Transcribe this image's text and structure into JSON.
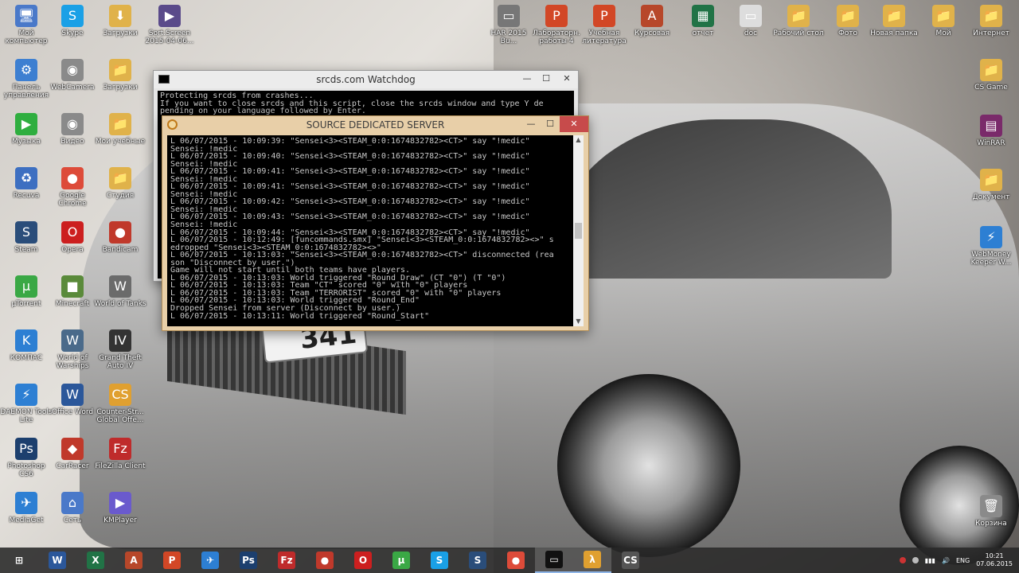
{
  "desktop": {
    "plate_text": "341",
    "icons_left": [
      {
        "label": "Мой компьютер",
        "glyph": "🖥",
        "color": "#4a79c9",
        "icon": "computer-icon"
      },
      {
        "label": "Skype",
        "glyph": "S",
        "color": "#1aa0e6",
        "icon": "skype-icon"
      },
      {
        "label": "Загрузки",
        "glyph": "⬇",
        "color": "#e0b24a",
        "icon": "downloads-icon"
      },
      {
        "label": "Sort.Screen 2015-04-06...",
        "glyph": "▶",
        "color": "#5a4a8a",
        "icon": "video-file-icon"
      },
      {
        "label": "Панель управления",
        "glyph": "⚙",
        "color": "#3d7fd1",
        "icon": "control-panel-icon"
      },
      {
        "label": "WebCamera",
        "glyph": "◉",
        "color": "#8a8a8a",
        "icon": "webcam-icon"
      },
      {
        "label": "Загрузки",
        "glyph": "📁",
        "color": "#e0b24a",
        "icon": "folder-icon"
      },
      {
        "label": "Музыка",
        "glyph": "▶",
        "color": "#2fae3f",
        "icon": "music-player-icon"
      },
      {
        "label": "Видео",
        "glyph": "◉",
        "color": "#8a8a8a",
        "icon": "video-icon"
      },
      {
        "label": "Мои учебные",
        "glyph": "📁",
        "color": "#e0b24a",
        "icon": "folder-icon"
      },
      {
        "label": "Recuva",
        "glyph": "♻",
        "color": "#3d6fc1",
        "icon": "recuva-icon"
      },
      {
        "label": "Google Chrome",
        "glyph": "●",
        "color": "#dd4b39",
        "icon": "chrome-icon"
      },
      {
        "label": "Студия",
        "glyph": "📁",
        "color": "#e0b24a",
        "icon": "folder-icon"
      },
      {
        "label": "Steam",
        "glyph": "S",
        "color": "#2a4d7a",
        "icon": "steam-icon"
      },
      {
        "label": "Opera",
        "glyph": "O",
        "color": "#cc1f1f",
        "icon": "opera-icon"
      },
      {
        "label": "Bandicam",
        "glyph": "●",
        "color": "#c0392b",
        "icon": "bandicam-icon"
      },
      {
        "label": "µTorrent",
        "glyph": "µ",
        "color": "#3aa845",
        "icon": "utorrent-icon"
      },
      {
        "label": "Minecraft",
        "glyph": "■",
        "color": "#5a8a3a",
        "icon": "minecraft-icon"
      },
      {
        "label": "World of Tanks",
        "glyph": "W",
        "color": "#6b6b6b",
        "icon": "wot-icon"
      },
      {
        "label": "КОМПАС",
        "glyph": "K",
        "color": "#2d7fd3",
        "icon": "kompas-icon"
      },
      {
        "label": "World of Warships",
        "glyph": "W",
        "color": "#4a6a8a",
        "icon": "wows-icon"
      },
      {
        "label": "Grand Theft Auto IV",
        "glyph": "IV",
        "color": "#333",
        "icon": "gta-icon"
      },
      {
        "label": "DAEMON Tools Lite",
        "glyph": "⚡",
        "color": "#2d7fd3",
        "icon": "daemon-tools-icon"
      },
      {
        "label": "Office Word",
        "glyph": "W",
        "color": "#2b579a",
        "icon": "word-icon"
      },
      {
        "label": "Counter-Str... Global Offe...",
        "glyph": "CS",
        "color": "#e0a030",
        "icon": "csgo-icon"
      },
      {
        "label": "Photoshop CS6",
        "glyph": "Ps",
        "color": "#1c3f6e",
        "icon": "photoshop-icon"
      },
      {
        "label": "CarRacer",
        "glyph": "◆",
        "color": "#c0392b",
        "icon": "game-icon"
      },
      {
        "label": "FileZilla Client",
        "glyph": "Fz",
        "color": "#bf2b2b",
        "icon": "filezilla-icon"
      },
      {
        "label": "MediaGet",
        "glyph": "✈",
        "color": "#2d7fd3",
        "icon": "mediaget-icon"
      },
      {
        "label": "Сеть",
        "glyph": "⌂",
        "color": "#4a79c9",
        "icon": "network-icon"
      },
      {
        "label": "KMPlayer",
        "glyph": "▶",
        "color": "#6a5acd",
        "icon": "kmplayer-icon"
      }
    ],
    "icons_top": [
      {
        "label": "HAR 2015 Bu...",
        "glyph": "▭",
        "color": "#777",
        "icon": "document-icon"
      },
      {
        "label": "Лабораторн. работы 4",
        "glyph": "P",
        "color": "#d24726",
        "icon": "ppt-icon"
      },
      {
        "label": "Учебная литература",
        "glyph": "P",
        "color": "#d24726",
        "icon": "ppt-icon"
      },
      {
        "label": "Курсовая",
        "glyph": "A",
        "color": "#b7472a",
        "icon": "access-icon"
      },
      {
        "label": "отчет",
        "glyph": "▦",
        "color": "#217346",
        "icon": "excel-icon"
      },
      {
        "label": "doc",
        "glyph": "▭",
        "color": "#ddd",
        "icon": "file-icon"
      },
      {
        "label": "Рабочий стол",
        "glyph": "📁",
        "color": "#e0b24a",
        "icon": "folder-icon"
      },
      {
        "label": "Фото",
        "glyph": "📁",
        "color": "#e0b24a",
        "icon": "folder-icon"
      },
      {
        "label": "Новая папка",
        "glyph": "📁",
        "color": "#e0b24a",
        "icon": "folder-icon"
      },
      {
        "label": "Мой",
        "glyph": "📁",
        "color": "#e0b24a",
        "icon": "folder-icon"
      },
      {
        "label": "Интернет",
        "glyph": "📁",
        "color": "#e0b24a",
        "icon": "folder-icon"
      }
    ],
    "icons_right": [
      {
        "label": "CS Game",
        "glyph": "📁",
        "color": "#e0b24a",
        "icon": "folder-icon"
      },
      {
        "label": "WinRAR",
        "glyph": "▤",
        "color": "#7a2a6a",
        "icon": "winrar-icon"
      },
      {
        "label": "Документ",
        "glyph": "📁",
        "color": "#e0b24a",
        "icon": "folder-icon"
      },
      {
        "label": "WebMoney Keeper W...",
        "glyph": "⚡",
        "color": "#2d7fd3",
        "icon": "webmoney-icon"
      },
      {
        "label": "Корзина",
        "glyph": "🗑",
        "color": "#8a8a8a",
        "icon": "recycle-bin-icon"
      }
    ]
  },
  "watchdog": {
    "title": "srcds.com Watchdog",
    "minimize": "—",
    "maximize": "☐",
    "close": "✕",
    "lines": [
      "Protecting srcds from crashes...",
      "If you want to close srcds and this script, close the srcds window and type Y de",
      "pending on your language followed by Enter."
    ]
  },
  "srcds": {
    "title": "SOURCE DEDICATED SERVER",
    "minimize": "—",
    "maximize": "☐",
    "close": "✕",
    "lines": [
      "L 06/07/2015 - 10:09:39: \"Sensei<3><STEAM_0:0:1674832782><CT>\" say \"!medic\"",
      "Sensei: !medic",
      "L 06/07/2015 - 10:09:40: \"Sensei<3><STEAM_0:0:1674832782><CT>\" say \"!medic\"",
      "Sensei: !medic",
      "L 06/07/2015 - 10:09:41: \"Sensei<3><STEAM_0:0:1674832782><CT>\" say \"!medic\"",
      "Sensei: !medic",
      "L 06/07/2015 - 10:09:41: \"Sensei<3><STEAM_0:0:1674832782><CT>\" say \"!medic\"",
      "Sensei: !medic",
      "L 06/07/2015 - 10:09:42: \"Sensei<3><STEAM_0:0:1674832782><CT>\" say \"!medic\"",
      "Sensei: !medic",
      "L 06/07/2015 - 10:09:43: \"Sensei<3><STEAM_0:0:1674832782><CT>\" say \"!medic\"",
      "Sensei: !medic",
      "L 06/07/2015 - 10:09:44: \"Sensei<3><STEAM_0:0:1674832782><CT>\" say \"!medic\"",
      "L 06/07/2015 - 10:12:49: [funcommands.smx] \"Sensei<3><STEAM_0:0:1674832782><>\" s",
      "edropped \"Sensei<3><STEAM_0:0:1674832782><>\"",
      "L 06/07/2015 - 10:13:03: \"Sensei<3><STEAM_0:0:1674832782><CT>\" disconnected (rea",
      "son \"Disconnect by user.\")",
      "Game will not start until both teams have players.",
      "L 06/07/2015 - 10:13:03: World triggered \"Round_Draw\" (CT \"0\") (T \"0\")",
      "L 06/07/2015 - 10:13:03: Team \"CT\" scored \"0\" with \"0\" players",
      "L 06/07/2015 - 10:13:03: Team \"TERRORIST\" scored \"0\" with \"0\" players",
      "L 06/07/2015 - 10:13:03: World triggered \"Round_End\"",
      "Dropped Sensei from server (Disconnect by user.)",
      "L 06/07/2015 - 10:13:11: World triggered \"Round_Start\""
    ]
  },
  "taskbar": {
    "buttons": [
      {
        "glyph": "⊞",
        "color": "transparent",
        "icon": "start-icon",
        "active": false
      },
      {
        "glyph": "W",
        "color": "#2b579a",
        "icon": "word-icon",
        "active": false
      },
      {
        "glyph": "X",
        "color": "#217346",
        "icon": "excel-icon",
        "active": false
      },
      {
        "glyph": "A",
        "color": "#b7472a",
        "icon": "access-icon",
        "active": false
      },
      {
        "glyph": "P",
        "color": "#d24726",
        "icon": "powerpoint-icon",
        "active": false
      },
      {
        "glyph": "✈",
        "color": "#2d7fd3",
        "icon": "mediaget-icon",
        "active": false
      },
      {
        "glyph": "Ps",
        "color": "#1c3f6e",
        "icon": "photoshop-icon",
        "active": false
      },
      {
        "glyph": "Fz",
        "color": "#bf2b2b",
        "icon": "filezilla-icon",
        "active": false
      },
      {
        "glyph": "●",
        "color": "#c0392b",
        "icon": "bandicam-icon",
        "active": false
      },
      {
        "glyph": "O",
        "color": "#cc1f1f",
        "icon": "opera-icon",
        "active": false
      },
      {
        "glyph": "µ",
        "color": "#3aa845",
        "icon": "utorrent-icon",
        "active": false
      },
      {
        "glyph": "S",
        "color": "#1aa0e6",
        "icon": "skype-icon",
        "active": false
      },
      {
        "glyph": "S",
        "color": "#2a4d7a",
        "icon": "steam-icon",
        "active": false
      },
      {
        "glyph": "●",
        "color": "#dd4b39",
        "icon": "chrome-icon",
        "active": false
      },
      {
        "glyph": "▭",
        "color": "#111",
        "icon": "cmd-icon",
        "active": true
      },
      {
        "glyph": "λ",
        "color": "#e0a030",
        "icon": "half-life-icon",
        "active": true
      },
      {
        "glyph": "CS",
        "color": "#555",
        "icon": "counter-strike-icon",
        "active": false
      }
    ],
    "lang": "ENG",
    "time": "10:21",
    "date": "07.06.2015"
  }
}
